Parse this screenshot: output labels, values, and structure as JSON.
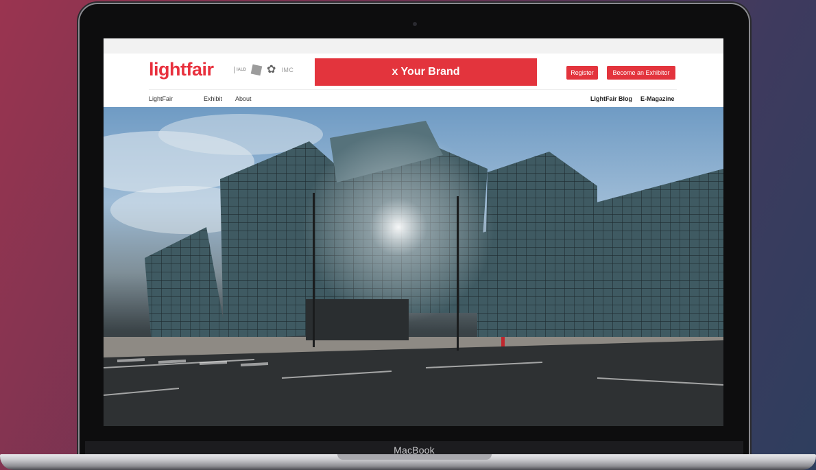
{
  "device": {
    "chin_label": "MacBook"
  },
  "site": {
    "logo_text": "lightfair",
    "partners": {
      "iald": "IALD",
      "imc": "IMC"
    },
    "banner_text": "x Your Brand",
    "buttons": {
      "register": "Register",
      "become_exhibitor": "Become an Exhibitor"
    },
    "nav_left": [
      "LightFair",
      "Exhibit",
      "About"
    ],
    "nav_right": [
      "LightFair Blog",
      "E-Magazine"
    ]
  },
  "colors": {
    "brand_red": "#e3343d",
    "logo_red": "#e8303d",
    "background_start": "#9a3450",
    "background_end": "#2e3e5e"
  },
  "icons": {
    "partner_badge": "badge-icon",
    "partner_gear": "gear-icon"
  },
  "hero": {
    "subject": "glass convention center building"
  }
}
